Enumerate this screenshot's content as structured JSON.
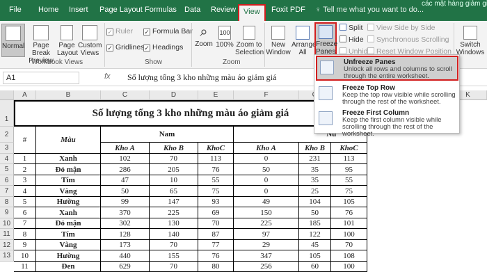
{
  "title_partial": "các mặt hàng giảm giá",
  "tabs": [
    "File",
    "Home",
    "Insert",
    "Page Layout",
    "Formulas",
    "Data",
    "Review",
    "View",
    "Foxit PDF"
  ],
  "tell_me": "Tell me what you want to do...",
  "ribbon": {
    "normal": "Normal",
    "page_break": "Page Break Preview",
    "page_layout": "Page Layout",
    "custom_views": "Custom Views",
    "workbook_views": "Workbook Views",
    "ruler": "Ruler",
    "gridlines": "Gridlines",
    "formula_bar": "Formula Bar",
    "headings": "Headings",
    "show": "Show",
    "zoom": "Zoom",
    "zoom100": "100%",
    "zoom_sel": "Zoom to Selection",
    "new_window": "New Window",
    "arrange_all": "Arrange All",
    "freeze": "Freeze Panes",
    "split": "Split",
    "hide": "Hide",
    "unhide": "Unhide",
    "view_side": "View Side by Side",
    "sync_scroll": "Synchronous Scrolling",
    "reset_pos": "Reset Window Position",
    "switch_windows": "Switch Windows"
  },
  "formula_bar": {
    "name_box": "A1",
    "fx": "fx",
    "content": "Số lượng tổng 3 kho những màu áo giảm giá"
  },
  "freeze_menu": [
    {
      "title": "Unfreeze Panes",
      "desc": "Unlock all rows and columns to scroll through the entire worksheet."
    },
    {
      "title": "Freeze Top Row",
      "desc": "Keep the top row visible while scrolling through the rest of the worksheet."
    },
    {
      "title": "Freeze First Column",
      "desc": "Keep the first column visible while scrolling through the rest of the worksheet."
    }
  ],
  "columns": [
    "A",
    "B",
    "C",
    "D",
    "E",
    "F",
    "G",
    "H",
    "I",
    "J",
    "K"
  ],
  "rows": [
    "1",
    "2",
    "3",
    "4",
    "5",
    "6",
    "7",
    "8",
    "9",
    "10",
    "11",
    "12",
    "13"
  ],
  "sheet": {
    "title": "Số lượng tổng 3 kho những màu áo giảm giá",
    "hash": "#",
    "mau": "Màu",
    "nam": "Nam",
    "nu": "Nữ",
    "subheads": [
      "Kho A",
      "Kho B",
      "KhoC",
      "Kho A",
      "Kho B",
      "KhoC"
    ],
    "data": [
      [
        "1",
        "Xanh",
        "102",
        "70",
        "113",
        "0",
        "231",
        "113"
      ],
      [
        "2",
        "Đỏ mận",
        "286",
        "205",
        "76",
        "50",
        "35",
        "95"
      ],
      [
        "3",
        "Tím",
        "47",
        "10",
        "55",
        "0",
        "35",
        "55"
      ],
      [
        "4",
        "Vàng",
        "50",
        "65",
        "75",
        "0",
        "25",
        "75"
      ],
      [
        "5",
        "Hường",
        "99",
        "147",
        "93",
        "49",
        "104",
        "105"
      ],
      [
        "6",
        "Xanh",
        "370",
        "225",
        "69",
        "150",
        "50",
        "76"
      ],
      [
        "7",
        "Đỏ mận",
        "302",
        "130",
        "70",
        "225",
        "185",
        "101"
      ],
      [
        "8",
        "Tím",
        "128",
        "140",
        "87",
        "97",
        "122",
        "100"
      ],
      [
        "9",
        "Vàng",
        "173",
        "70",
        "77",
        "29",
        "45",
        "70"
      ],
      [
        "10",
        "Hường",
        "440",
        "155",
        "76",
        "347",
        "105",
        "108"
      ],
      [
        "11",
        "Đen",
        "629",
        "70",
        "80",
        "256",
        "60",
        "100"
      ]
    ]
  }
}
